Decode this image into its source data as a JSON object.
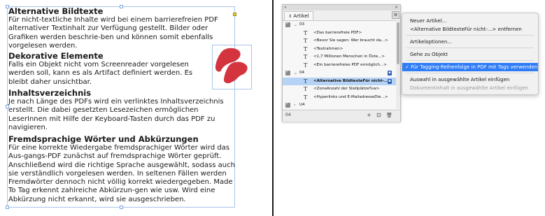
{
  "document": {
    "sections": [
      {
        "heading": "Alternative Bildtexte",
        "body": "Für nicht-textliche Inhalte wird bei einem barrierefreien PDF alternativer Textinhalt zur Verfügung gestellt. Bilder oder Grafiken werden beschrie-ben und können somit ebenfalls vorgelesen werden."
      },
      {
        "heading": "Dekorative Elemente",
        "body": "Falls ein Objekt nicht vom Screenreader vorgelesen werden soll, kann es als Artifact definiert werden. Es bleibt daher unsichtbar."
      },
      {
        "heading": "Inhaltsverzeichnis",
        "body": "Je nach Länge des PDFs wird ein verlinktes Inhaltsverzeichnis erstellt. Die dabei gesetzten Lesezeichen ermöglichen LeserInnen mit Hilfe der Keyboard-Tasten durch das PDF zu navigieren."
      },
      {
        "heading": "Fremdsprachige Wörter und Abkürzungen",
        "body": "Für eine korrekte Wiedergabe fremdsprachiger Wörter wird das Aus-gangs-PDF zunächst auf fremdsprachige Wörter geprüft. Anschließend wird die richtige Sprache ausgewählt, sodass auch sie verständlich vorgelesen werden. In seltenen Fällen werden Fremdwörter dennoch nicht völlig korrekt wiedergegeben. Made To Tag erkennt zahlreiche Abkürzun-gen wie usw. Wird eine Abkürzung nicht erkannt, wird sie ausgeschrieben."
      }
    ],
    "graphic_color": "#d3343e"
  },
  "panel": {
    "collapse_glyph": "«",
    "close_glyph": "×",
    "tab_label": "Artikel",
    "tab_icon": "sort-arrows-icon",
    "menu_button_icon": "hamburger-menu-icon",
    "rows": [
      {
        "type": "article",
        "label": "03",
        "checked": true,
        "expanded": true
      },
      {
        "type": "story",
        "label": "<Das barrierefreie PDF>"
      },
      {
        "type": "story",
        "label": "<Bevor Sie sagen: Wer braucht da...>"
      },
      {
        "type": "story",
        "label": "<Textrahmen>"
      },
      {
        "type": "story",
        "label": "<1,7 Millionen Menschen in Öste...>"
      },
      {
        "type": "story",
        "label": "<Ein barrierefreies PDF ermöglich...>"
      },
      {
        "type": "article",
        "label": "04",
        "checked": true,
        "expanded": true,
        "badge": true
      },
      {
        "type": "story",
        "label": "<Alternative BildtexteFür nicht-...>",
        "selected": true,
        "badge": true
      },
      {
        "type": "story",
        "label": "<ZoneAnzahl der Stellplätze%w>"
      },
      {
        "type": "story",
        "label": "<Hyperlinks und E-MailadresseDie...>"
      },
      {
        "type": "article",
        "label": "U4",
        "checked": true,
        "expanded": false
      }
    ],
    "footer": {
      "count": "04",
      "add_glyph": "+",
      "add_selection_glyph": "⊡",
      "delete_glyph": "🗑"
    }
  },
  "menu": {
    "checkmark": "✓",
    "groups": [
      [
        {
          "label": "Neuer Artikel..."
        },
        {
          "label": "<Alternative BildtexteFür nicht-...> entfernen"
        }
      ],
      [
        {
          "label": "Artikeloptionen..."
        }
      ],
      [
        {
          "label": "Gehe zu Objekt"
        }
      ],
      [
        {
          "label": "Für Tagging-Reihenfolge in PDF mit Tags verwenden",
          "checked": true,
          "highlighted": true
        }
      ],
      [
        {
          "label": "Auswahl in ausgewählte Artikel einfügen"
        },
        {
          "label": "Dokumentinhalt in ausgewählte Artikel einfügen",
          "disabled": true
        }
      ]
    ]
  }
}
